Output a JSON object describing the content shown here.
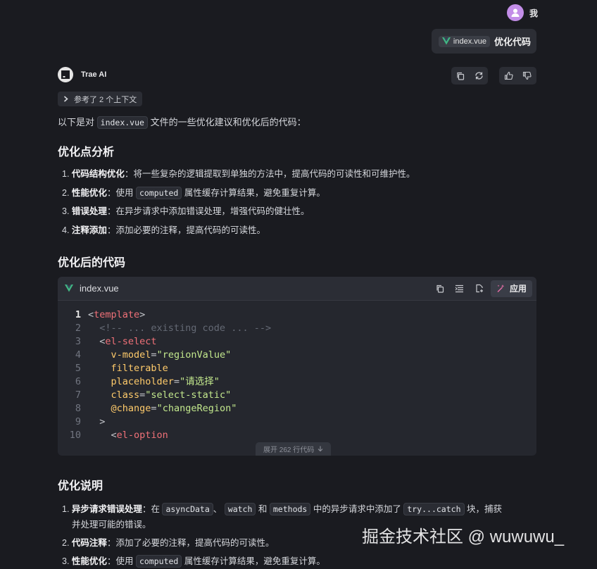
{
  "user": {
    "name": "我",
    "message": {
      "file_chip": "index.vue",
      "text": "优化代码"
    }
  },
  "ai": {
    "name": "Trae AI",
    "context_chip": "参考了 2 个上下文",
    "intro": {
      "before": "以下是对",
      "code": "index.vue",
      "after": "文件的一些优化建议和优化后的代码："
    },
    "section1_title": "优化点分析",
    "points": [
      {
        "num": "1.",
        "title": "代码结构优化",
        "sep": "：",
        "text": "将一些复杂的逻辑提取到单独的方法中，提高代码的可读性和可维护性。"
      },
      {
        "num": "2.",
        "title": "性能优化",
        "sep": "：",
        "before": "使用",
        "code": "computed",
        "after": "属性缓存计算结果，避免重复计算。"
      },
      {
        "num": "3.",
        "title": "错误处理",
        "sep": "：",
        "text": "在异步请求中添加错误处理，增强代码的健壮性。"
      },
      {
        "num": "4.",
        "title": "注释添加",
        "sep": "：",
        "text": "添加必要的注释，提高代码的可读性。"
      }
    ],
    "section2_title": "优化后的代码",
    "code_block": {
      "filename": "index.vue",
      "apply_label": "应用",
      "expand_label": "展开 262 行代码",
      "lines": [
        {
          "n": "1",
          "text": "<template>"
        },
        {
          "n": "2",
          "text": "  <!-- ... existing code ... -->"
        },
        {
          "n": "3",
          "text": "  <el-select"
        },
        {
          "n": "4",
          "text": "    v-model=\"regionValue\""
        },
        {
          "n": "5",
          "text": "    filterable"
        },
        {
          "n": "6",
          "text": "    placeholder=\"请选择\""
        },
        {
          "n": "7",
          "text": "    class=\"select-static\""
        },
        {
          "n": "8",
          "text": "    @change=\"changeRegion\""
        },
        {
          "n": "9",
          "text": "  >"
        },
        {
          "n": "10",
          "text": "    <el-option"
        }
      ]
    },
    "section3_title": "优化说明",
    "notes": [
      {
        "num": "1.",
        "title": "异步请求错误处理",
        "sep": "：",
        "p1": "在",
        "c1": "asyncData",
        "p2": "、",
        "c2": "watch",
        "p3": "和",
        "c3": "methods",
        "p4": "中的异步请求中添加了",
        "c4": "try...catch",
        "p5": "块，捕获",
        "line2": "并处理可能的错误。"
      },
      {
        "num": "2.",
        "title": "代码注释",
        "sep": "：",
        "text": "添加了必要的注释，提高代码的可读性。"
      },
      {
        "num": "3.",
        "title": "性能优化",
        "sep": "：",
        "before": "使用",
        "code": "computed",
        "after": "属性缓存计算结果，避免重复计算。"
      }
    ]
  },
  "watermark": "掘金技术社区 @ wuwuwu_"
}
